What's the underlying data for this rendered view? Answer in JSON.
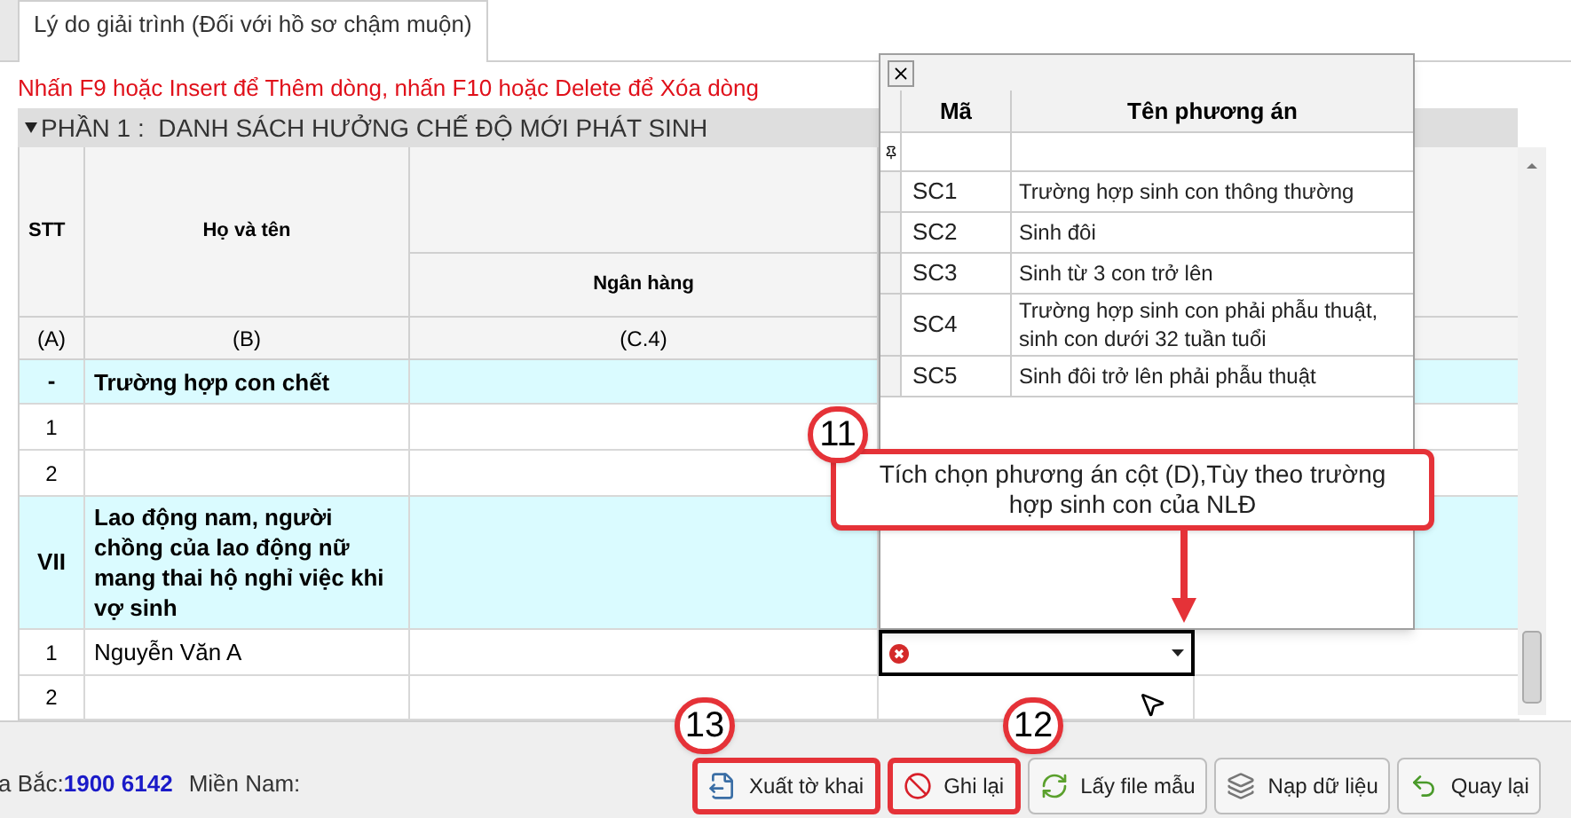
{
  "tab": {
    "label": "Lý do giải trình (Đối với hồ sơ chậm muộn)",
    "selected": true
  },
  "instruction": "Nhấn F9 hoặc Insert để Thêm dòng, nhấn F10 hoặc Delete để Xóa dòng",
  "section": {
    "title": "PHẦN 1 :  DANH SÁCH HƯỞNG CHẾ ĐỘ MỚI PHÁT SINH",
    "expanded": true
  },
  "table": {
    "columns": [
      "STT",
      "Họ và tên",
      "Ngân hàng"
    ],
    "code_row": [
      "(A)",
      "(B)",
      "(C.4)"
    ],
    "rows": [
      {
        "kind": "group",
        "stt": "-",
        "name": "Trường hợp con chết"
      },
      {
        "kind": "item",
        "stt": "1",
        "name": ""
      },
      {
        "kind": "item",
        "stt": "2",
        "name": ""
      },
      {
        "kind": "group",
        "stt": "VII",
        "name": "Lao động nam, người chồng của lao động nữ mang thai hộ nghỉ việc khi vợ sinh"
      },
      {
        "kind": "active",
        "stt": "1",
        "name": "Nguyễn Văn A"
      },
      {
        "kind": "item",
        "stt": "2",
        "name": ""
      }
    ]
  },
  "dropdown": {
    "columns": [
      "Mã",
      "Tên phương án"
    ],
    "options": [
      {
        "code": "SC1",
        "name": "Trường hợp sinh con thông thường"
      },
      {
        "code": "SC2",
        "name": "Sinh đôi"
      },
      {
        "code": "SC3",
        "name": "Sinh từ 3 con trở lên"
      },
      {
        "code": "SC4",
        "name": "Trường hợp sinh con phải phẫu thuật, sinh con dưới 32 tuần tuổi"
      },
      {
        "code": "SC5",
        "name": "Sinh đôi trở lên phải phẫu thuật"
      }
    ]
  },
  "callout": {
    "number": "11",
    "text": "Tích chọn phương án cột (D),Tùy theo trường hợp sinh con của NLĐ"
  },
  "footer": {
    "hotline_label": "a Bắc:",
    "hotline_number": "1900 6142",
    "south_label": "Miền Nam:"
  },
  "buttons": [
    {
      "kind": "export",
      "label": "Xuất tờ khai",
      "highlighted": true,
      "number": "13"
    },
    {
      "kind": "save",
      "label": "Ghi lại",
      "highlighted": true,
      "number": "12"
    },
    {
      "kind": "template",
      "label": "Lấy file mẫu",
      "highlighted": false
    },
    {
      "kind": "import",
      "label": "Nạp dữ liệu",
      "highlighted": false
    },
    {
      "kind": "back",
      "label": "Quay lại",
      "highlighted": false
    }
  ]
}
